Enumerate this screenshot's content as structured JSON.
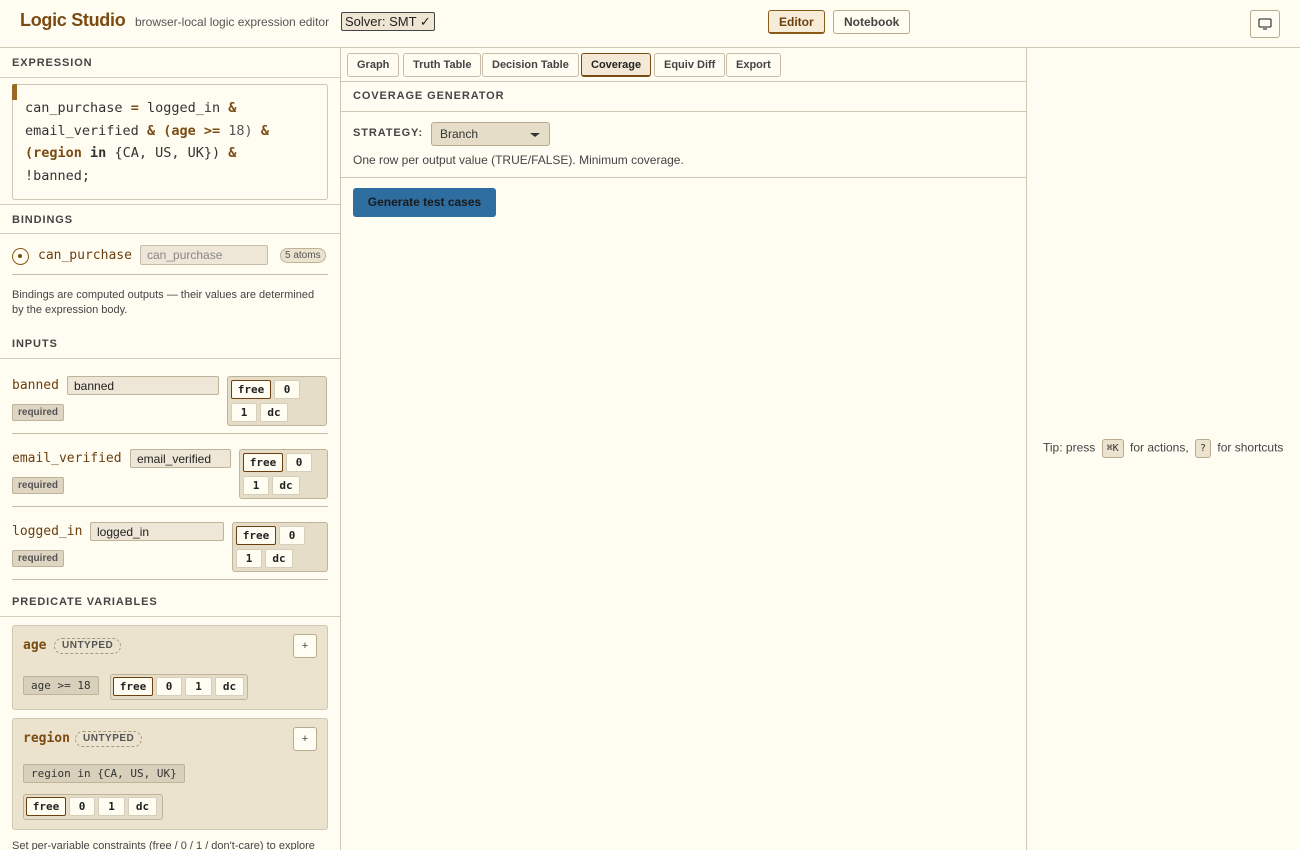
{
  "header": {
    "title": "Logic Studio",
    "subtitle": "browser-local logic expression editor",
    "solver_label": "Solver: SMT ✓",
    "modes": [
      {
        "label": "Editor",
        "active": true
      },
      {
        "label": "Notebook",
        "active": false
      }
    ],
    "screen_icon": "monitor-icon"
  },
  "expression": {
    "heading": "EXPRESSION",
    "tokens": {
      "t1": "can_purchase",
      "t2": "=",
      "t3": "logged_in",
      "t4": "&",
      "t5": "email_verified",
      "t6": "&",
      "t7": "(age",
      "t8": ">=",
      "t9": "18)",
      "t10": "&",
      "t11": "(region",
      "t12": "in",
      "t13": "{CA, US, UK})",
      "t14": "&",
      "t15": "!banned;"
    }
  },
  "bindings": {
    "heading": "BINDINGS",
    "name": "can_purchase",
    "input_value": "can_purchase",
    "atoms_badge": "5 atoms",
    "note": "Bindings are computed outputs — their values are determined by the expression body."
  },
  "inputs": {
    "heading": "INPUTS",
    "items": [
      {
        "name": "banned",
        "value": "banned",
        "badge": "required",
        "opts": [
          "free",
          "0",
          "1",
          "dc"
        ],
        "selected": "free"
      },
      {
        "name": "email_verified",
        "value": "email_verified",
        "badge": "required",
        "opts": [
          "free",
          "0",
          "1",
          "dc"
        ],
        "selected": "free"
      },
      {
        "name": "logged_in",
        "value": "logged_in",
        "badge": "required",
        "opts": [
          "free",
          "0",
          "1",
          "dc"
        ],
        "selected": "free"
      }
    ]
  },
  "predicates": {
    "heading": "PREDICATE VARIABLES",
    "items": [
      {
        "name": "age",
        "type_badge": "UNTYPED",
        "add_label": "+",
        "chip": "age >= 18",
        "opts": [
          "free",
          "0",
          "1",
          "dc"
        ],
        "selected": "free"
      },
      {
        "name": "region",
        "type_badge": "UNTYPED",
        "add_label": "+",
        "chip": "region in {CA, US, UK}",
        "opts": [
          "free",
          "0",
          "1",
          "dc"
        ],
        "selected": "free"
      }
    ],
    "note": "Set per-variable constraints (free / 0 / 1 / don't-care) to explore"
  },
  "tabs": [
    {
      "label": "Graph",
      "active": false
    },
    {
      "label": "Truth Table",
      "active": false
    },
    {
      "label": "Decision Table",
      "active": false
    },
    {
      "label": "Coverage",
      "active": true
    },
    {
      "label": "Equiv Diff",
      "active": false
    },
    {
      "label": "Export",
      "active": false
    }
  ],
  "coverage": {
    "heading": "COVERAGE GENERATOR",
    "strategy_label": "STRATEGY:",
    "strategy_value": "Branch",
    "strategy_desc": "One row per output value (TRUE/FALSE). Minimum coverage.",
    "generate_label": "Generate test cases"
  },
  "tip": {
    "prefix": "Tip: press",
    "key1": "⌘K",
    "mid": "for actions,",
    "key2": "?",
    "suffix": "for shortcuts"
  },
  "colors": {
    "accent": "#7a4b12",
    "primary_button": "#2e6da0",
    "background": "#fffcf2"
  }
}
